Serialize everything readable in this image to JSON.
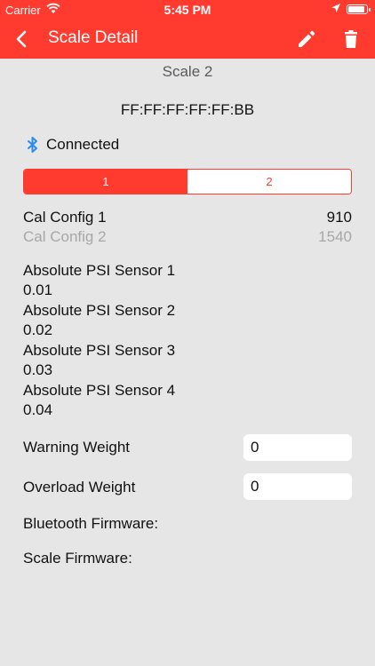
{
  "status": {
    "carrier": "Carrier",
    "time": "5:45 PM"
  },
  "nav": {
    "title": "Scale Detail"
  },
  "scale": {
    "name": "Scale 2",
    "mac": "FF:FF:FF:FF:FF:BB",
    "connection": "Connected"
  },
  "segments": [
    "1",
    "2"
  ],
  "selected_segment": "1",
  "cal": [
    {
      "label": "Cal Config 1",
      "value": "910"
    },
    {
      "label": "Cal Config 2",
      "value": "1540"
    }
  ],
  "sensors": [
    {
      "label": "Absolute PSI Sensor 1",
      "value": "0.01"
    },
    {
      "label": "Absolute PSI Sensor 2",
      "value": "0.02"
    },
    {
      "label": "Absolute PSI Sensor 3",
      "value": "0.03"
    },
    {
      "label": "Absolute PSI Sensor 4",
      "value": "0.04"
    }
  ],
  "warning": {
    "label": "Warning Weight",
    "value": "0"
  },
  "overload": {
    "label": "Overload Weight",
    "value": "0"
  },
  "firmware": {
    "bluetooth": "Bluetooth Firmware:",
    "scale": "Scale Firmware:"
  },
  "colors": {
    "accent": "#ff3b30",
    "background": "#e6e6e6",
    "bluetooth": "#2a8cf0"
  },
  "icons": {
    "back": "chevron-left-icon",
    "edit": "pencil-icon",
    "delete": "trash-icon",
    "bluetooth": "bluetooth-icon",
    "wifi": "wifi-icon",
    "location": "location-arrow-icon",
    "battery": "battery-icon"
  }
}
